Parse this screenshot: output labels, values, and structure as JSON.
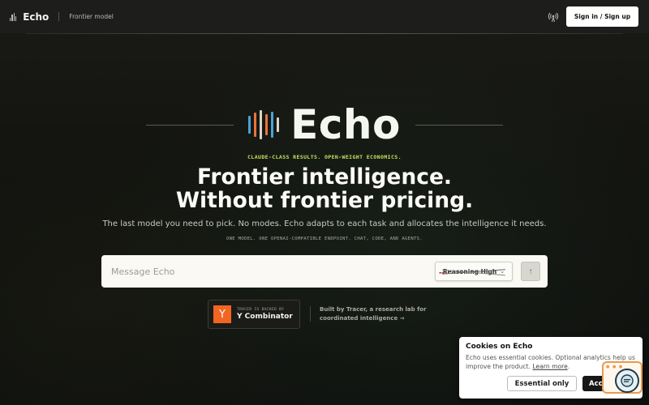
{
  "header": {
    "brand_name": "Echo",
    "brand_subtitle": "Frontier model",
    "signin_label": "Sign in / Sign up",
    "icons": {
      "brand": "audio-bars-icon",
      "status": "radio-tower-icon"
    }
  },
  "hero": {
    "logo_word": "Echo",
    "bar_colors": [
      "#4ba3d6",
      "#e8743b",
      "#d9d4c8",
      "#e8743b",
      "#4ba3d6",
      "#d9d4c8"
    ],
    "tagline": "CLAUDE-CLASS RESULTS. OPEN-WEIGHT ECONOMICS.",
    "headline_line1": "Frontier intelligence.",
    "headline_line2": "Without frontier pricing.",
    "subtext": "The last model you need to pick. No modes. Echo adapts to each task and allocates the intelligence it needs.",
    "caption": "ONE MODEL. ONE OPENAI-COMPATIBLE ENDPOINT. CHAT, CODE, AND AGENTS."
  },
  "composer": {
    "placeholder": "Message Echo",
    "reasoning_label": "Reasoning High",
    "send_icon": "arrow-up-icon"
  },
  "backing": {
    "small_label": "TRACER IS BACKED BY",
    "company": "Y Combinator",
    "logo_letter": "Y",
    "built_by": "Built by Tracer, a research lab for coordinated intelligence →"
  },
  "cookie_banner": {
    "title": "Cookies on Echo",
    "text": "Echo uses essential cookies. Optional analytics help us improve the product.",
    "link": "Learn more",
    "link_suffix": ".",
    "essential_label": "Essential only",
    "accept_label": "Accept"
  },
  "colors": {
    "accent_tagline": "#c8e060",
    "yc_orange": "#f26522",
    "background": "#12130f"
  }
}
